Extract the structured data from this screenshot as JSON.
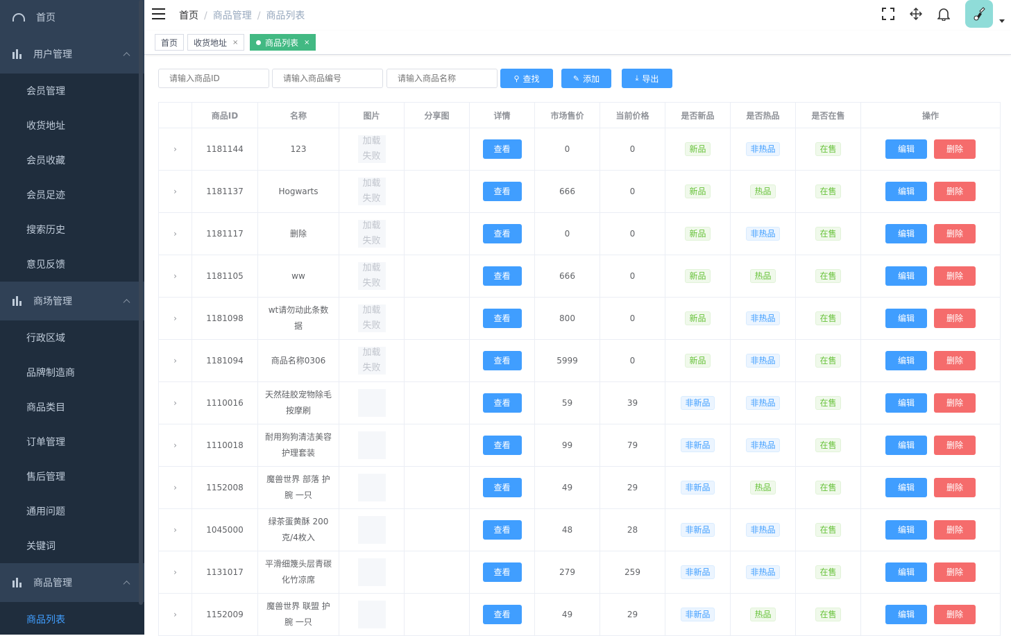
{
  "sidebar": {
    "home": "首页",
    "groups": [
      {
        "label": "用户管理",
        "items": [
          "会员管理",
          "收货地址",
          "会员收藏",
          "会员足迹",
          "搜索历史",
          "意见反馈"
        ]
      },
      {
        "label": "商场管理",
        "items": [
          "行政区域",
          "品牌制造商",
          "商品类目",
          "订单管理",
          "售后管理",
          "通用问题",
          "关键词"
        ]
      },
      {
        "label": "商品管理",
        "items": [
          "商品列表"
        ]
      }
    ]
  },
  "header": {
    "breadcrumb": [
      "首页",
      "商品管理",
      "商品列表"
    ]
  },
  "tags": [
    "首页",
    "收货地址",
    "商品列表"
  ],
  "filters": {
    "id_placeholder": "请输入商品ID",
    "sn_placeholder": "请输入商品编号",
    "name_placeholder": "请输入商品名称",
    "search": "查找",
    "add": "添加",
    "export": "导出"
  },
  "table": {
    "columns": [
      "",
      "商品ID",
      "名称",
      "图片",
      "分享图",
      "详情",
      "市场售价",
      "当前价格",
      "是否新品",
      "是否热品",
      "是否在售",
      "操作"
    ],
    "img_fail": [
      "加载",
      "失败"
    ],
    "view": "查看",
    "edit": "编辑",
    "delete": "删除",
    "rows": [
      {
        "id": "1181144",
        "name": "123",
        "img": "fail",
        "market": "0",
        "price": "0",
        "isNew": "新品",
        "isHot": "非热品",
        "onSale": "在售"
      },
      {
        "id": "1181137",
        "name": "Hogwarts",
        "img": "fail",
        "market": "666",
        "price": "0",
        "isNew": "新品",
        "isHot": "热品",
        "onSale": "在售"
      },
      {
        "id": "1181117",
        "name": "删除",
        "img": "fail",
        "market": "0",
        "price": "0",
        "isNew": "新品",
        "isHot": "非热品",
        "onSale": "在售"
      },
      {
        "id": "1181105",
        "name": "ww",
        "img": "fail",
        "market": "666",
        "price": "0",
        "isNew": "新品",
        "isHot": "热品",
        "onSale": "在售"
      },
      {
        "id": "1181098",
        "name": "wt请勿动此条数据",
        "img": "fail",
        "market": "800",
        "price": "0",
        "isNew": "新品",
        "isHot": "非热品",
        "onSale": "在售"
      },
      {
        "id": "1181094",
        "name": "商品名称0306",
        "img": "fail",
        "market": "5999",
        "price": "0",
        "isNew": "新品",
        "isHot": "非热品",
        "onSale": "在售"
      },
      {
        "id": "1110016",
        "name": "天然硅胶宠物除毛按摩刷",
        "img": "empty",
        "market": "59",
        "price": "39",
        "isNew": "非新品",
        "isHot": "非热品",
        "onSale": "在售"
      },
      {
        "id": "1110018",
        "name": "耐用狗狗清洁美容护理套装",
        "img": "empty",
        "market": "99",
        "price": "79",
        "isNew": "非新品",
        "isHot": "非热品",
        "onSale": "在售"
      },
      {
        "id": "1152008",
        "name": "魔兽世界 部落 护腕 一只",
        "img": "empty",
        "market": "49",
        "price": "29",
        "isNew": "非新品",
        "isHot": "热品",
        "onSale": "在售"
      },
      {
        "id": "1045000",
        "name": "绿茶蛋黄酥 200克/4枚入",
        "img": "empty",
        "market": "48",
        "price": "28",
        "isNew": "非新品",
        "isHot": "非热品",
        "onSale": "在售"
      },
      {
        "id": "1131017",
        "name": "平滑细篾头层青碳化竹凉席",
        "img": "empty",
        "market": "279",
        "price": "259",
        "isNew": "非新品",
        "isHot": "非热品",
        "onSale": "在售"
      },
      {
        "id": "1152009",
        "name": "魔兽世界 联盟 护腕 一只",
        "img": "empty",
        "market": "49",
        "price": "29",
        "isNew": "非新品",
        "isHot": "热品",
        "onSale": "在售"
      }
    ]
  }
}
